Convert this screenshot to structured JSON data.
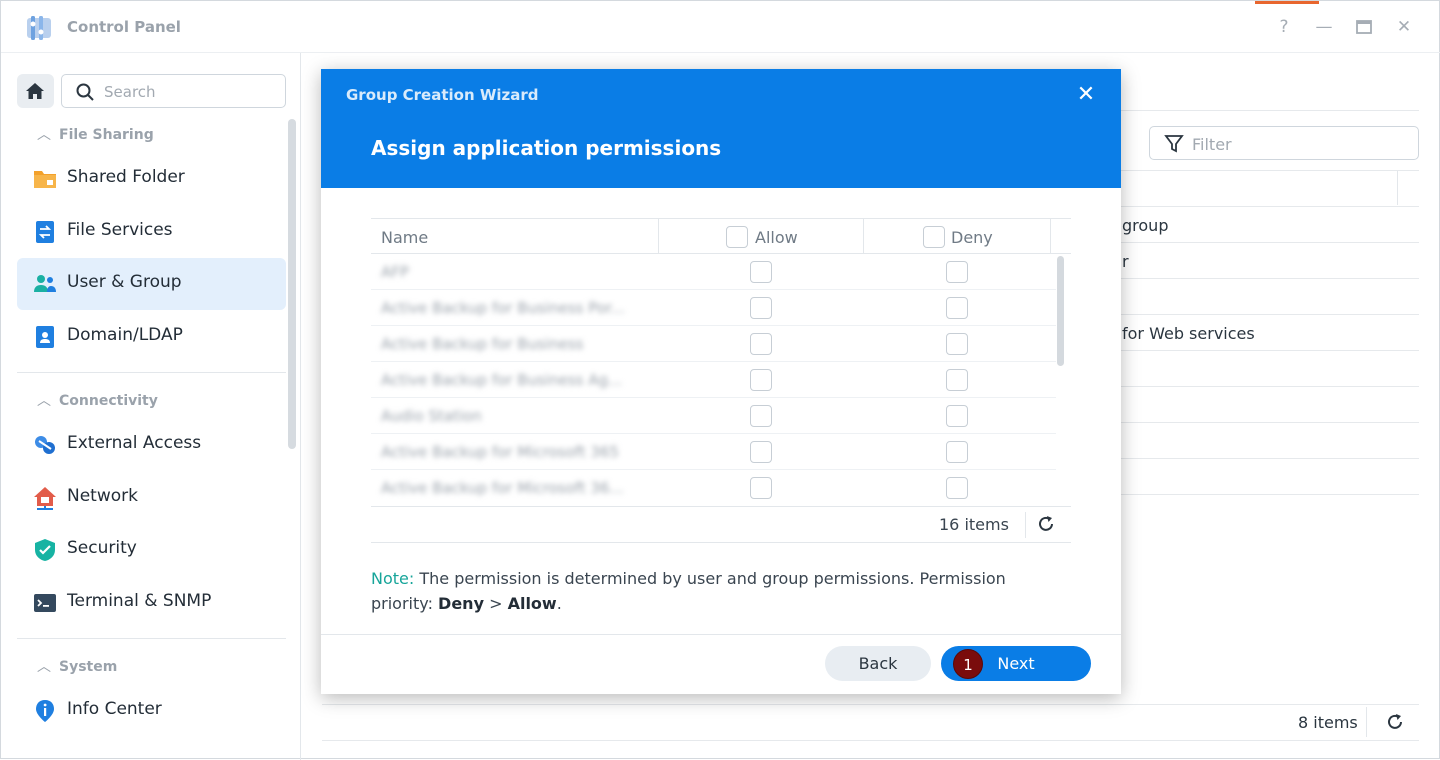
{
  "window": {
    "title": "Control Panel",
    "controls": [
      "?",
      "—",
      "▭",
      "✕"
    ]
  },
  "sidebar": {
    "search_placeholder": "Search",
    "sections": [
      {
        "title": "File Sharing",
        "items": [
          "Shared Folder",
          "File Services",
          "User & Group",
          "Domain/LDAP"
        ]
      },
      {
        "title": "Connectivity",
        "items": [
          "External Access",
          "Network",
          "Security",
          "Terminal & SNMP"
        ]
      },
      {
        "title": "System",
        "items": [
          "Info Center"
        ]
      }
    ],
    "active_item": "User & Group"
  },
  "background_panel": {
    "filter_placeholder": "Filter",
    "rows": [
      "group",
      "r",
      "for Web services"
    ],
    "items_count": "8 items"
  },
  "modal": {
    "wizard_name": "Group Creation Wizard",
    "step_title": "Assign application permissions",
    "columns": {
      "name": "Name",
      "allow": "Allow",
      "deny": "Deny"
    },
    "rows": [
      "AFP",
      "Active Backup for Business Por...",
      "Active Backup for Business",
      "Active Backup for Business Ag...",
      "Audio Station",
      "Active Backup for Microsoft 365",
      "Active Backup for Microsoft 36..."
    ],
    "items_count": "16 items",
    "note_label": "Note:",
    "note_text": " The permission is determined by user and group permissions. Permission priority: ",
    "note_deny": "Deny",
    "note_gt": " > ",
    "note_allow": "Allow",
    "note_end": ".",
    "back_label": "Back",
    "next_label": "Next",
    "step_badge": "1"
  },
  "colors": {
    "accent": "#0a7de6",
    "note_label": "#17a59a",
    "badge": "#7a0c0c"
  }
}
